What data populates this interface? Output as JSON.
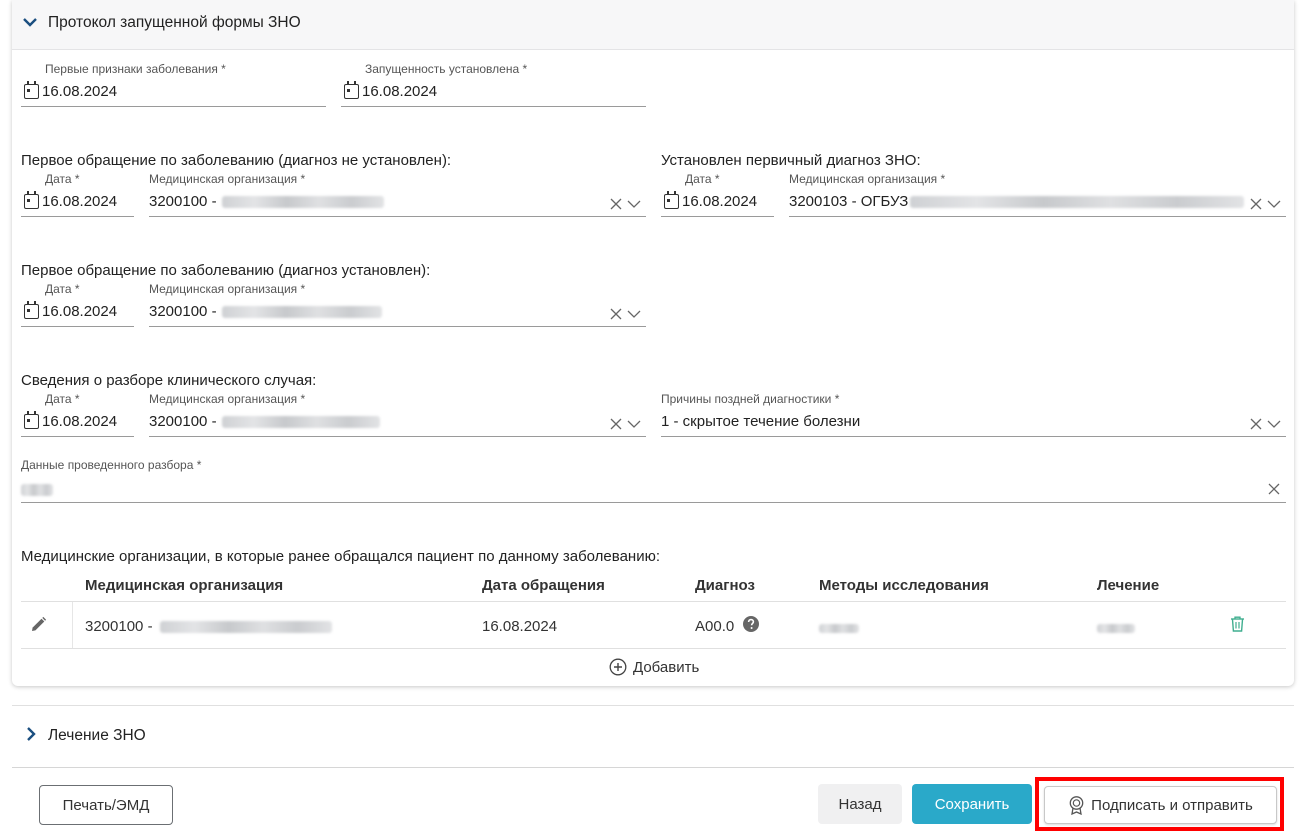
{
  "section1": {
    "title": "Протокол запущенной формы ЗНО"
  },
  "first_signs": {
    "label": "Первые признаки заболевания *",
    "value": "16.08.2024"
  },
  "neglect_set": {
    "label": "Запущенность установлена *",
    "value": "16.08.2024"
  },
  "group_first_visit_no_dx": {
    "title": "Первое обращение по заболеванию (диагноз не установлен):",
    "date_label": "Дата *",
    "date_value": "16.08.2024",
    "org_label": "Медицинская организация *",
    "org_value": "3200100 -"
  },
  "group_primary_dx": {
    "title": "Установлен первичный диагноз ЗНО:",
    "date_label": "Дата *",
    "date_value": "16.08.2024",
    "org_label": "Медицинская организация *",
    "org_value": "3200103 - ОГБУЗ"
  },
  "group_first_visit_dx": {
    "title": "Первое обращение по заболеванию (диагноз установлен):",
    "date_label": "Дата *",
    "date_value": "16.08.2024",
    "org_label": "Медицинская организация *",
    "org_value": "3200100 -"
  },
  "group_case_review": {
    "title": "Сведения о разборе клинического случая:",
    "date_label": "Дата *",
    "date_value": "16.08.2024",
    "org_label": "Медицинская организация *",
    "org_value": "3200100 -"
  },
  "late_reasons": {
    "label": "Причины поздней диагностики *",
    "value": "1 - скрытое течение болезни"
  },
  "review_data": {
    "label": "Данные проведенного разбора *"
  },
  "orgs_table": {
    "title": "Медицинские организации, в которые ранее обращался пациент по данному заболеванию:",
    "columns": [
      "Медицинская организация",
      "Дата обращения",
      "Диагноз",
      "Методы исследования",
      "Лечение"
    ],
    "rows": [
      {
        "org": "3200100 -",
        "date": "16.08.2024",
        "diagnosis": "A00.0"
      }
    ],
    "add_label": "Добавить"
  },
  "section2": {
    "title": "Лечение ЗНО"
  },
  "footer": {
    "print_label": "Печать/ЭМД",
    "back_label": "Назад",
    "save_label": "Сохранить",
    "sign_label": "Подписать и отправить"
  },
  "colors": {
    "primary": "#2aa9c9",
    "highlight": "#ff0000",
    "accent_green": "#3fae8f"
  },
  "icons": [
    "chevron-down-icon",
    "chevron-right-icon",
    "calendar-icon",
    "clear-icon",
    "dropdown-icon",
    "edit-icon",
    "help-icon",
    "trash-icon",
    "plus-circle-icon",
    "signature-icon"
  ]
}
